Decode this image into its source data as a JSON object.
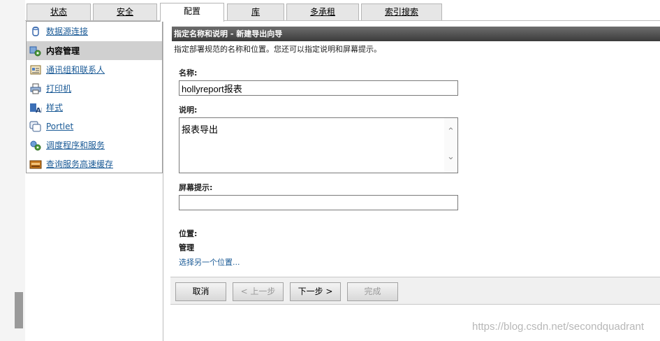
{
  "tabs": [
    {
      "label": "状态",
      "active": false
    },
    {
      "label": "安全",
      "active": false
    },
    {
      "label": "配置",
      "active": true
    },
    {
      "label": "库",
      "active": false
    },
    {
      "label": "多承租",
      "active": false
    },
    {
      "label": "索引搜索",
      "active": false
    }
  ],
  "sidebar": {
    "items": [
      {
        "label": "数据源连接",
        "icon": "database-cylinder-icon",
        "active": false
      },
      {
        "label": "内容管理",
        "icon": "content-gear-icon",
        "active": true
      },
      {
        "label": "通讯组和联系人",
        "icon": "address-book-icon",
        "active": false
      },
      {
        "label": "打印机",
        "icon": "printer-icon",
        "active": false
      },
      {
        "label": "样式",
        "icon": "styles-icon",
        "active": false
      },
      {
        "label": "Portlet",
        "icon": "portlet-icon",
        "active": false
      },
      {
        "label": "调度程序和服务",
        "icon": "scheduler-gears-icon",
        "active": false
      },
      {
        "label": "查询服务高速缓存",
        "icon": "cache-box-icon",
        "active": false
      }
    ]
  },
  "wizard": {
    "header": "指定名称和说明 - 新建导出向导",
    "subtitle": "指定部署规范的名称和位置。您还可以指定说明和屏幕提示。",
    "name_label": "名称:",
    "name_value": "hollyreport报表",
    "desc_label": "说明:",
    "desc_value": "报表导出",
    "tooltip_label": "屏幕提示:",
    "tooltip_value": "",
    "location_label": "位置:",
    "location_value": "管理",
    "location_link": "选择另一个位置..."
  },
  "buttons": {
    "cancel": "取消",
    "back": "< 上一步",
    "next": "下一步 >",
    "finish": "完成"
  },
  "watermark": "https://blog.csdn.net/secondquadrant"
}
